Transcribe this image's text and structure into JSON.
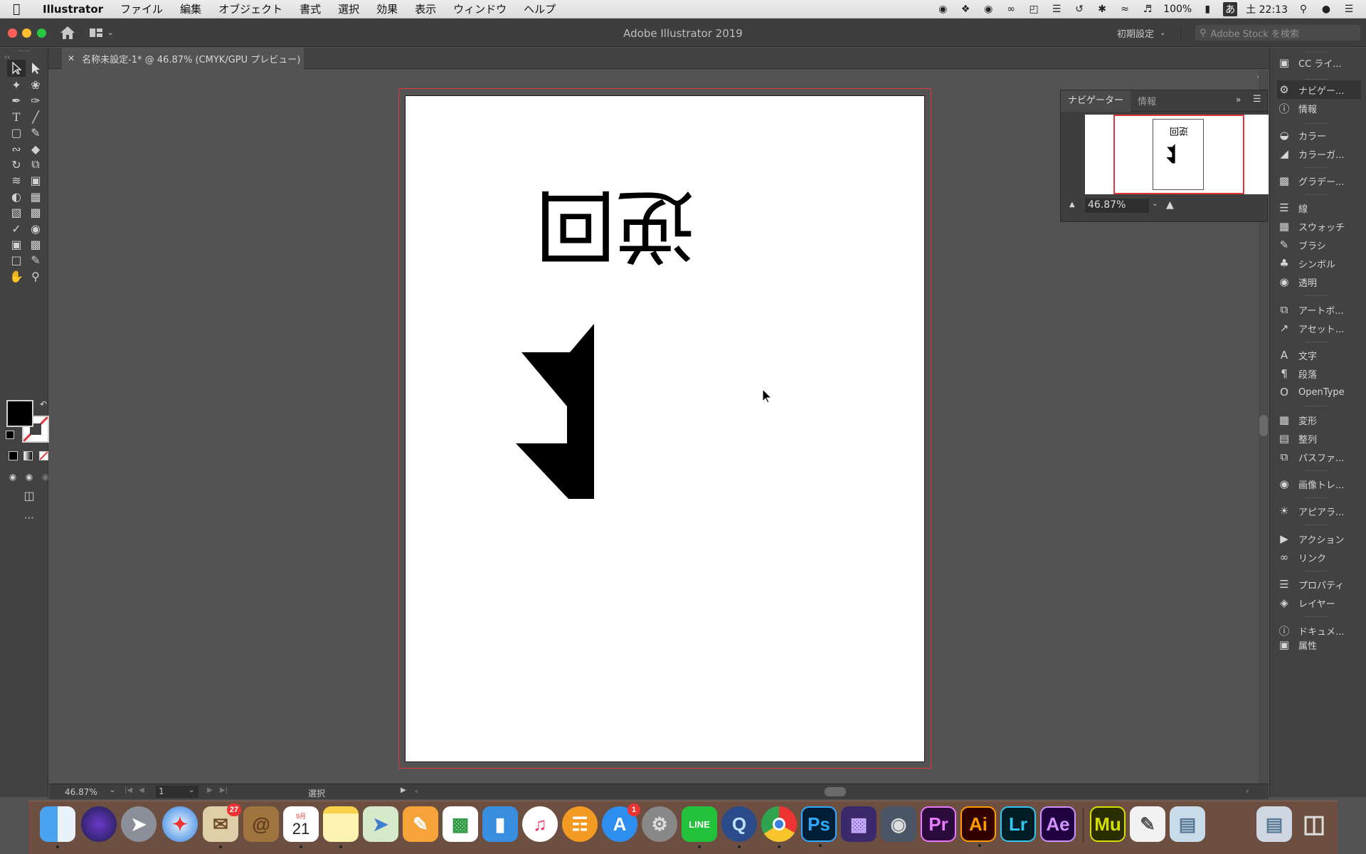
{
  "menubar": {
    "app_name": "Illustrator",
    "menus": [
      "ファイル",
      "編集",
      "オブジェクト",
      "書式",
      "選択",
      "効果",
      "表示",
      "ウィンドウ",
      "ヘルプ"
    ],
    "battery": "100%",
    "input_method": "あ",
    "clock": "土 22:13"
  },
  "titlebar": {
    "title": "Adobe Illustrator 2019",
    "workspace": "初期設定",
    "search_placeholder": "Adobe Stock を検索"
  },
  "document": {
    "tab_label": "名称未設定-1* @ 46.87% (CMYK/GPU プレビュー)",
    "artwork_text": "逆回"
  },
  "statusbar": {
    "zoom": "46.87%",
    "page": "1",
    "tool": "選択"
  },
  "navigator": {
    "tab_navigator": "ナビゲーター",
    "tab_info": "情報",
    "zoom": "46.87%",
    "thumb_text": "逆回"
  },
  "right_dock": {
    "items": [
      "CC ライ...",
      "ナビゲー...",
      "情報",
      "カラー",
      "カラーガ...",
      "グラデー...",
      "線",
      "スウォッチ",
      "ブラシ",
      "シンボル",
      "透明",
      "アートボ...",
      "アセット...",
      "文字",
      "段落",
      "OpenType",
      "変形",
      "整列",
      "パスファ...",
      "画像トレ...",
      "アピアラ...",
      "アクション",
      "リンク",
      "プロパティ",
      "レイヤー",
      "ドキュメ...",
      "属性"
    ]
  },
  "dock": {
    "mail_badge": "27",
    "appstore_badge": "1",
    "calendar_month": "9月",
    "calendar_day": "21",
    "labels": {
      "ps": "Ps",
      "pr": "Pr",
      "ai": "Ai",
      "lr": "Lr",
      "ae": "Ae",
      "mu": "Mu",
      "line": "LINE"
    }
  },
  "colors": {
    "accent_red": "#e0383a",
    "canvas_bg": "#535353",
    "panel_bg": "#424242"
  }
}
